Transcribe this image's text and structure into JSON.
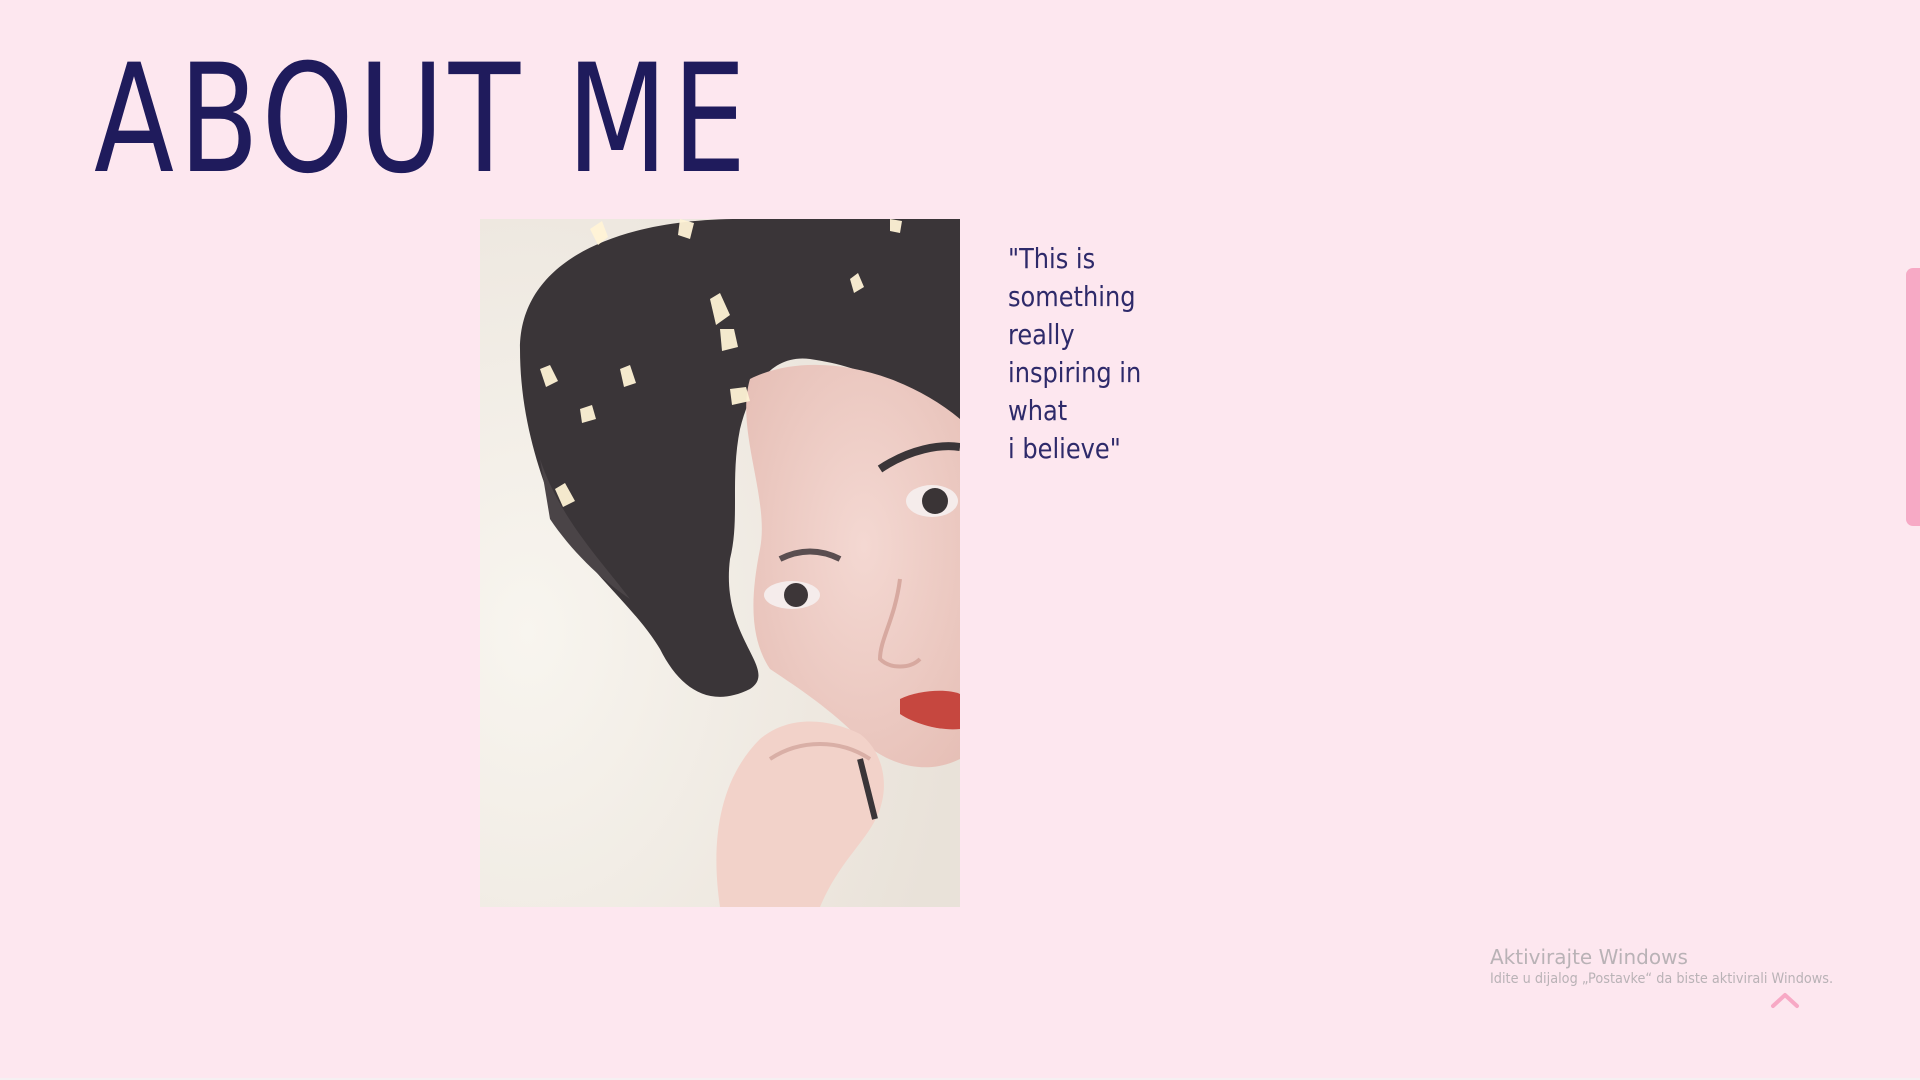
{
  "header": {
    "title": "ABOUT ME"
  },
  "about": {
    "quote_lines": [
      "\"This is",
      "something really",
      "inspiring in what",
      "i believe\""
    ]
  },
  "os_overlay": {
    "activation_title": "Aktivirajte Windows",
    "activation_subtitle": "Idite u dijalog „Postavke“ da biste aktivirali Windows."
  },
  "colors": {
    "background": "#fde7ef",
    "title": "#1f1b5c",
    "accent": "#f7a9c5"
  },
  "icons": {
    "scroll_top": "chevron-up-icon"
  }
}
